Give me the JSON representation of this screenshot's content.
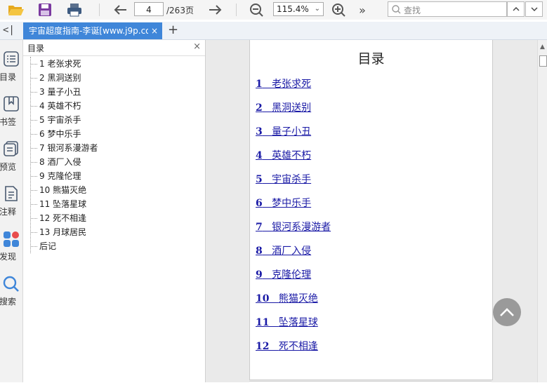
{
  "toolbar": {
    "page_current": "4",
    "page_total": "/263页",
    "zoom": "115.4%",
    "zoom_dropdown_glyph": "⌄",
    "more_glyph": "»",
    "search_placeholder": "查找",
    "icons": [
      "open-folder-icon",
      "save-icon",
      "print-icon",
      "back-arrow-icon",
      "forward-arrow-icon",
      "zoom-out-icon",
      "zoom-in-icon",
      "more-icon",
      "search-icon",
      "chevron-up-icon",
      "chevron-down-icon"
    ]
  },
  "tabbar": {
    "collapse_glyph": "<|",
    "tab_title": "宇宙超度指南-李诞[www.j9p.co",
    "tab_close": "×",
    "new_tab": "+"
  },
  "rail": {
    "items": [
      {
        "label": "目录",
        "icon": "list-icon"
      },
      {
        "label": "书签",
        "icon": "bookmark-icon"
      },
      {
        "label": "预览",
        "icon": "preview-icon"
      },
      {
        "label": "注释",
        "icon": "annotation-icon"
      },
      {
        "label": "发现",
        "icon": "discover-icon"
      },
      {
        "label": "搜索",
        "icon": "search-icon"
      }
    ]
  },
  "toc_panel": {
    "title": "目录",
    "close": "×",
    "items": [
      "1 老张求死",
      "2 黑洞送别",
      "3 量子小丑",
      "4 英雄不朽",
      "5 宇宙杀手",
      "6 梦中乐手",
      "7 银河系漫游者",
      "8 酒厂入侵",
      "9 克隆伦理",
      "10 熊猫灭绝",
      "11 坠落星球",
      "12 死不相逢",
      "13 月球居民",
      "后记"
    ]
  },
  "document": {
    "heading": "目录",
    "chapters": [
      {
        "num": "1",
        "title": "老张求死"
      },
      {
        "num": "2",
        "title": "黑洞送别"
      },
      {
        "num": "3",
        "title": "量子小丑"
      },
      {
        "num": "4",
        "title": "英雄不朽"
      },
      {
        "num": "5",
        "title": "宇宙杀手"
      },
      {
        "num": "6",
        "title": "梦中乐手"
      },
      {
        "num": "7",
        "title": "银河系漫游者"
      },
      {
        "num": "8",
        "title": "酒厂入侵"
      },
      {
        "num": "9",
        "title": "克隆伦理"
      },
      {
        "num": "10",
        "title": "熊猫灭绝"
      },
      {
        "num": "11",
        "title": "坠落星球"
      },
      {
        "num": "12",
        "title": "死不相逢"
      }
    ],
    "link_color": "#1a1aa6"
  },
  "colors": {
    "accent": "#3f86d9",
    "fab": "#9a9a9a"
  }
}
